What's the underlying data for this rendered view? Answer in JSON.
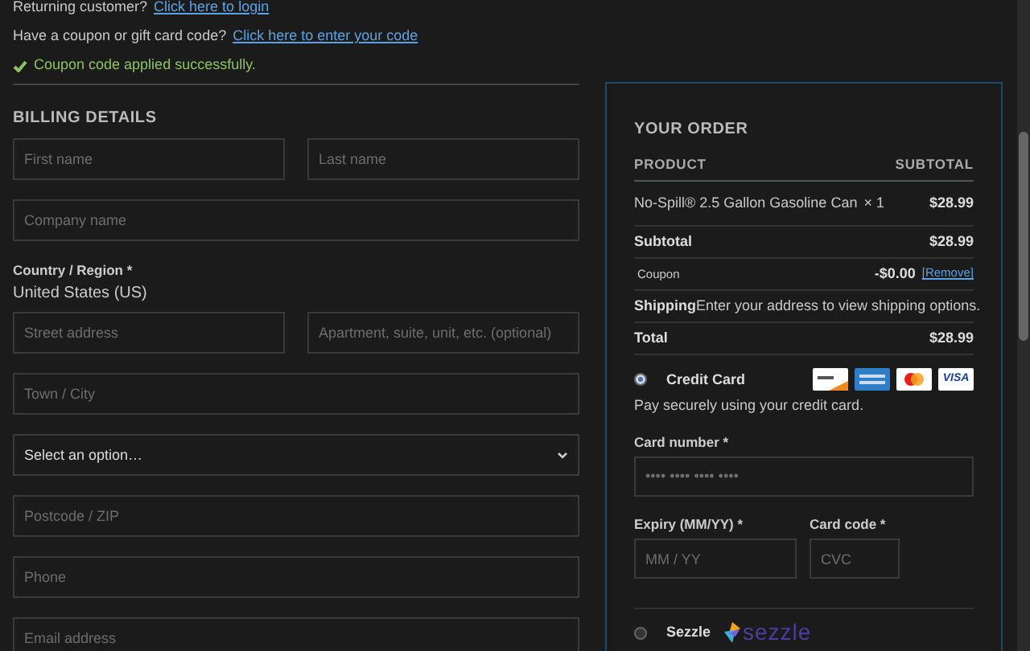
{
  "notices": [
    {
      "kind": "link",
      "text": "Returning customer?",
      "link": "Click here to login"
    },
    {
      "kind": "link",
      "text": "Have a coupon or gift card code?",
      "link": "Click here to enter your code"
    },
    {
      "kind": "success",
      "text": "Coupon code applied successfully."
    }
  ],
  "billing": {
    "title": "BILLING DETAILS",
    "fields": [
      [
        {
          "kind": "input",
          "placeholder": "First name"
        },
        {
          "kind": "input",
          "placeholder": "Last name"
        }
      ],
      [
        {
          "kind": "input",
          "placeholder": "Company name"
        }
      ],
      [
        {
          "kind": "static",
          "label": "Country / Region *",
          "value": "United States (US)"
        }
      ],
      [
        {
          "kind": "input",
          "placeholder": "Street address"
        },
        {
          "kind": "input",
          "placeholder": "Apartment, suite, unit, etc. (optional)"
        }
      ],
      [
        {
          "kind": "input",
          "placeholder": "Town / City"
        }
      ],
      [
        {
          "kind": "select",
          "value": "Select an option…"
        }
      ],
      [
        {
          "kind": "input",
          "placeholder": "Postcode / ZIP"
        }
      ],
      [
        {
          "kind": "input",
          "placeholder": "Phone"
        }
      ],
      [
        {
          "kind": "input",
          "placeholder": "Email address"
        }
      ]
    ]
  },
  "order": {
    "title": "YOUR ORDER",
    "columns": [
      "PRODUCT",
      "SUBTOTAL"
    ],
    "rows": [
      {
        "kind": "item",
        "label": "No-Spill® 2.5 Gallon Gasoline Can",
        "qty": "× 1",
        "value": "$28.99"
      },
      {
        "kind": "total",
        "label": "Subtotal",
        "value": "$28.99"
      },
      {
        "kind": "coupon",
        "label": "Coupon",
        "value": "-$0.00",
        "link": "[Remove]"
      },
      {
        "kind": "note",
        "label": "Shipping",
        "value": "Enter your address to view shipping options."
      },
      {
        "kind": "total",
        "label": "Total",
        "value": "$28.99"
      }
    ],
    "payments": [
      {
        "kind": "card",
        "label": "Credit Card",
        "selected": true,
        "description": "Pay securely using your credit card.",
        "brands": [
          {
            "kind": "discover"
          },
          {
            "kind": "amex"
          },
          {
            "kind": "mastercard"
          },
          {
            "kind": "visa",
            "text": "VISA"
          }
        ],
        "fields": [
          {
            "label": "Card number *",
            "placeholder": "•••• •••• •••• ••••"
          },
          {
            "label": "Expiry (MM/YY) *",
            "placeholder": "MM / YY"
          },
          {
            "label": "Card code *",
            "placeholder": "CVC"
          }
        ]
      },
      {
        "kind": "sezzle",
        "label": "Sezzle",
        "selected": false,
        "logo_text": "sezzle"
      }
    ]
  }
}
